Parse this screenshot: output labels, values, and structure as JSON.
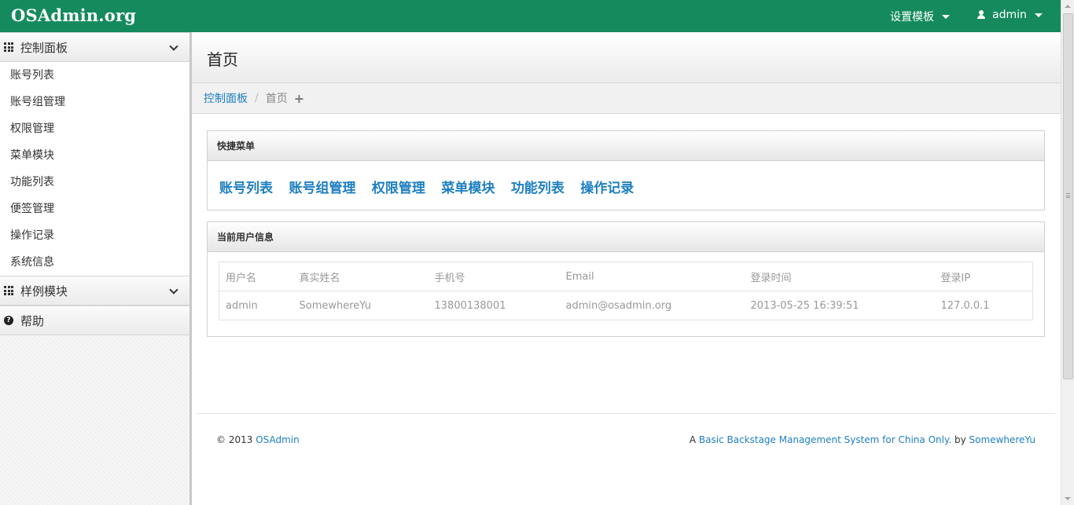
{
  "navbar": {
    "brand": "OSAdmin.org",
    "template_menu": "设置模板",
    "user_menu": "admin"
  },
  "sidebar": {
    "sections": [
      {
        "label": "控制面板",
        "icon": "grid-icon"
      },
      {
        "label": "样例模块",
        "icon": "grid-icon"
      },
      {
        "label": "帮助",
        "icon": "question-circle-icon"
      }
    ],
    "items": [
      "账号列表",
      "账号组管理",
      "权限管理",
      "菜单模块",
      "功能列表",
      "便签管理",
      "操作记录",
      "系统信息"
    ]
  },
  "page": {
    "title": "首页",
    "breadcrumb": {
      "parent": "控制面板",
      "current": "首页",
      "add": "+"
    }
  },
  "quick_menu": {
    "title": "快捷菜单",
    "links": [
      "账号列表",
      "账号组管理",
      "权限管理",
      "菜单模块",
      "功能列表",
      "操作记录"
    ]
  },
  "user_info": {
    "title": "当前用户信息",
    "headers": [
      "用户名",
      "真实姓名",
      "手机号",
      "Email",
      "登录时间",
      "登录IP"
    ],
    "row": [
      "admin",
      "SomewhereYu",
      "13800138001",
      "admin@osadmin.org",
      "2013-05-25 16:39:51",
      "127.0.0.1"
    ]
  },
  "footer": {
    "copyright": "© 2013",
    "brand_link": "OSAdmin",
    "prefix": "A",
    "tagline_link": "Basic Backstage Management System for China Only.",
    "by": "by",
    "author_link": "SomewhereYu"
  },
  "colors": {
    "navbar": "#148a5d",
    "link": "#1e7fc1"
  }
}
